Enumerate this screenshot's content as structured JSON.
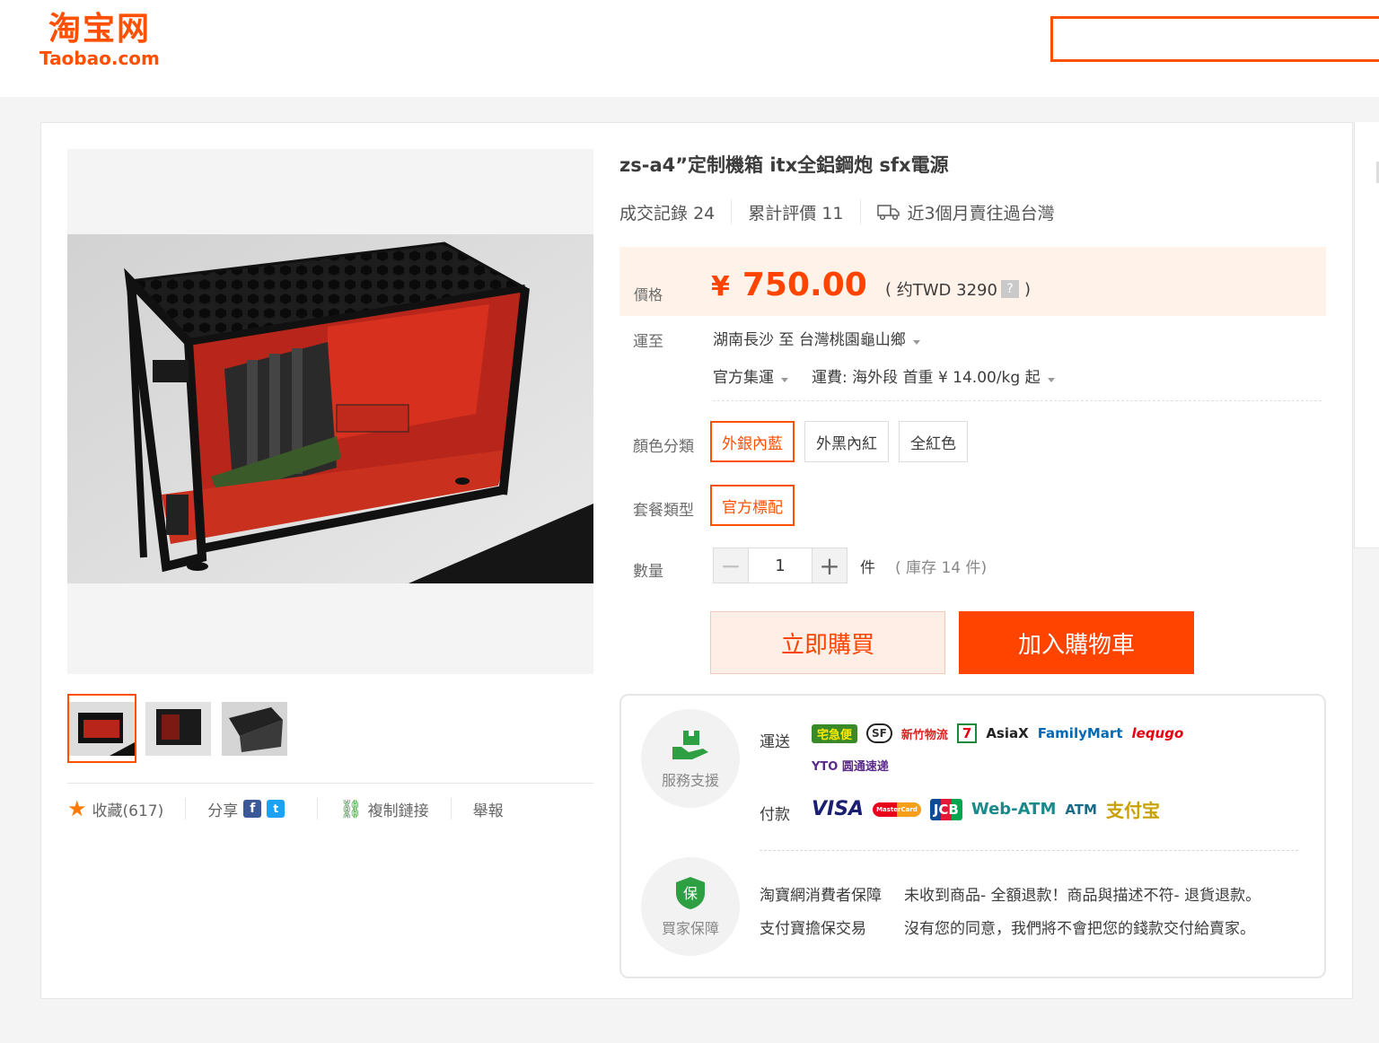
{
  "header": {
    "logo_cn": "淘宝网",
    "logo_en": "Taobao.com",
    "search_value": ""
  },
  "colors": {
    "accent": "#ff5000",
    "price": "#ff4400",
    "price_bg": "#fff2e8",
    "buy_bg": "#ffeee5"
  },
  "product": {
    "title": "zs-a4”定制機箱 itx全鋁鋼炮 sfx電源",
    "sales_label": "成交記錄",
    "sales_count": "24",
    "reviews_label": "累計評價",
    "reviews_count": "11",
    "shipped_note": "近3個月賣往過台灣"
  },
  "price": {
    "label": "價格",
    "currency": "¥",
    "value": "750.00",
    "approx_open": "(",
    "approx_text": "约TWD 3290",
    "help_icon": "?",
    "approx_close": ")"
  },
  "shipping": {
    "label": "運至",
    "from": "湖南長沙",
    "to_word": "至",
    "to": "台灣桃園龜山鄉",
    "method": "官方集運",
    "fee": "運費: 海外段 首重 ¥ 14.00/kg 起"
  },
  "sku": {
    "color_label": "顏色分類",
    "colors": [
      "外銀內藍",
      "外黑內紅",
      "全紅色"
    ],
    "selected_color": 0,
    "package_label": "套餐類型",
    "packages": [
      "官方標配"
    ],
    "selected_package": 0
  },
  "quantity": {
    "label": "數量",
    "minus": "−",
    "value": "1",
    "plus": "+",
    "unit": "件",
    "stock": "( 庫存 14 件)"
  },
  "buttons": {
    "buy_now": "立即購買",
    "add_cart": "加入購物車"
  },
  "gallery": {
    "thumb_count": 3,
    "active": 0
  },
  "share": {
    "favorite": "收藏(617)",
    "share": "分享",
    "facebook_glyph": "f",
    "twitter_glyph": "t",
    "copy_link": "複制鏈接",
    "report": "舉報"
  },
  "service": {
    "support_title": "服務支援",
    "shipping_label": "運送",
    "shipping_logos": [
      "宅急便",
      "SF",
      "新竹物流",
      "7",
      "AsiaX",
      "FamilyMart",
      "lequgo",
      "YTO 圆通速递"
    ],
    "payment_label": "付款",
    "payment_logos": [
      "VISA",
      "MasterCard",
      "JCB",
      "Web-ATM",
      "ATM",
      "支付宝"
    ],
    "protect_title": "買家保障",
    "protect_icon": "保",
    "guarantee_1_label": "淘寶網消費者保障",
    "guarantee_1_text": "未收到商品- 全額退款！商品與描述不符- 退貨退款。",
    "guarantee_2_label": "支付寶擔保交易",
    "guarantee_2_text": "沒有您的同意，我們將不會把您的錢款交付給賣家。"
  }
}
